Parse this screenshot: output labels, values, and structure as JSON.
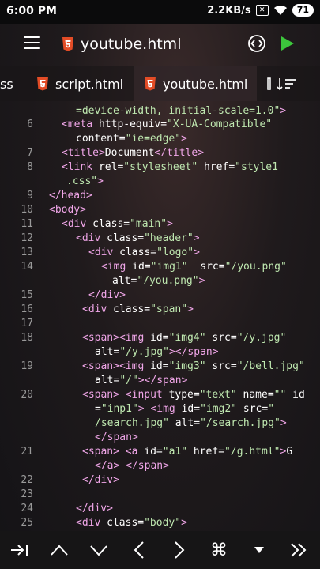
{
  "statusbar": {
    "time": "6:00 PM",
    "speed": "2.2KB/s",
    "battery": "71"
  },
  "appbar": {
    "title": "youtube.html"
  },
  "tabs": [
    {
      "label": "ss"
    },
    {
      "label": "script.html"
    },
    {
      "label": "youtube.html"
    }
  ],
  "colors": {
    "accent_play": "#3cc63c",
    "html_badge": "#e34c26",
    "tag": "#f0a6e8",
    "string": "#bfe8b0"
  },
  "editor": {
    "lines": [
      {
        "ln": "",
        "parts": [
          {
            "t": "str",
            "v": "=device-width, initial-scale=1.0\""
          },
          {
            "t": "tag",
            "v": ">"
          }
        ]
      },
      {
        "ln": "6",
        "parts": [
          {
            "t": "tag",
            "v": "<meta "
          },
          {
            "t": "attr",
            "v": "http-equiv="
          },
          {
            "t": "str",
            "v": "\"X-UA-Compatible\""
          }
        ]
      },
      {
        "ln": "",
        "parts": [
          {
            "t": "attr",
            "v": "content="
          },
          {
            "t": "str",
            "v": "\"ie=edge\""
          },
          {
            "t": "tag",
            "v": ">"
          }
        ]
      },
      {
        "ln": "7",
        "parts": [
          {
            "t": "tag",
            "v": "<title>"
          },
          {
            "t": "txt",
            "v": "Document"
          },
          {
            "t": "tag",
            "v": "</title>"
          }
        ]
      },
      {
        "ln": "8",
        "parts": [
          {
            "t": "tag",
            "v": "<link "
          },
          {
            "t": "attr",
            "v": "rel="
          },
          {
            "t": "str",
            "v": "\"stylesheet\""
          },
          {
            "t": "attr",
            "v": " href="
          },
          {
            "t": "str",
            "v": "\"style1"
          }
        ]
      },
      {
        "ln": "",
        "parts": [
          {
            "t": "str",
            "v": ".css\""
          },
          {
            "t": "tag",
            "v": ">"
          }
        ]
      },
      {
        "ln": "9",
        "parts": [
          {
            "t": "tag",
            "v": "</head>"
          }
        ]
      },
      {
        "ln": "10",
        "parts": [
          {
            "t": "tag",
            "v": "<body>"
          }
        ]
      },
      {
        "ln": "11",
        "parts": [
          {
            "t": "tag",
            "v": "<div "
          },
          {
            "t": "attr",
            "v": "class="
          },
          {
            "t": "str",
            "v": "\"main\""
          },
          {
            "t": "tag",
            "v": ">"
          }
        ]
      },
      {
        "ln": "12",
        "parts": [
          {
            "t": "tag",
            "v": "<div "
          },
          {
            "t": "attr",
            "v": "class="
          },
          {
            "t": "str",
            "v": "\"header\""
          },
          {
            "t": "tag",
            "v": ">"
          }
        ]
      },
      {
        "ln": "13",
        "parts": [
          {
            "t": "tag",
            "v": "<div "
          },
          {
            "t": "attr",
            "v": "class="
          },
          {
            "t": "str",
            "v": "\"logo\""
          },
          {
            "t": "tag",
            "v": ">"
          }
        ]
      },
      {
        "ln": "14",
        "parts": [
          {
            "t": "tag",
            "v": "<img "
          },
          {
            "t": "attr",
            "v": "id="
          },
          {
            "t": "str",
            "v": "\"img1\""
          },
          {
            "t": "attr",
            "v": "  src="
          },
          {
            "t": "str",
            "v": "\"/you.png\""
          }
        ]
      },
      {
        "ln": "",
        "parts": [
          {
            "t": "attr",
            "v": "alt="
          },
          {
            "t": "str",
            "v": "\"/you.png\""
          },
          {
            "t": "tag",
            "v": ">"
          }
        ]
      },
      {
        "ln": "15",
        "parts": [
          {
            "t": "tag",
            "v": "</div>"
          }
        ]
      },
      {
        "ln": "16",
        "parts": [
          {
            "t": "tag",
            "v": "<div "
          },
          {
            "t": "attr",
            "v": "class="
          },
          {
            "t": "str",
            "v": "\"span\""
          },
          {
            "t": "tag",
            "v": ">"
          }
        ]
      },
      {
        "ln": "17",
        "parts": []
      },
      {
        "ln": "18",
        "parts": [
          {
            "t": "tag",
            "v": "<span><img "
          },
          {
            "t": "attr",
            "v": "id="
          },
          {
            "t": "str",
            "v": "\"img4\""
          },
          {
            "t": "attr",
            "v": " src="
          },
          {
            "t": "str",
            "v": "\"/y.jpg\""
          }
        ]
      },
      {
        "ln": "",
        "parts": [
          {
            "t": "attr",
            "v": "alt="
          },
          {
            "t": "str",
            "v": "\"/y.jpg\""
          },
          {
            "t": "tag",
            "v": "></span>"
          }
        ]
      },
      {
        "ln": "19",
        "parts": [
          {
            "t": "tag",
            "v": "<span><img "
          },
          {
            "t": "attr",
            "v": "id="
          },
          {
            "t": "str",
            "v": "\"img3\""
          },
          {
            "t": "attr",
            "v": " src="
          },
          {
            "t": "str",
            "v": "\"/bell.jpg\""
          }
        ]
      },
      {
        "ln": "",
        "parts": [
          {
            "t": "attr",
            "v": "alt="
          },
          {
            "t": "str",
            "v": "\"/\""
          },
          {
            "t": "tag",
            "v": "></span>"
          }
        ]
      },
      {
        "ln": "20",
        "parts": [
          {
            "t": "tag",
            "v": "<span> <input "
          },
          {
            "t": "attr",
            "v": "type="
          },
          {
            "t": "str",
            "v": "\"text\""
          },
          {
            "t": "attr",
            "v": " name="
          },
          {
            "t": "str",
            "v": "\"\""
          },
          {
            "t": "attr",
            "v": " id"
          }
        ]
      },
      {
        "ln": "",
        "parts": [
          {
            "t": "attr",
            "v": "="
          },
          {
            "t": "str",
            "v": "\"inp1\""
          },
          {
            "t": "tag",
            "v": "> <img "
          },
          {
            "t": "attr",
            "v": "id="
          },
          {
            "t": "str",
            "v": "\"img2\""
          },
          {
            "t": "attr",
            "v": " src="
          },
          {
            "t": "str",
            "v": "\""
          }
        ]
      },
      {
        "ln": "",
        "parts": [
          {
            "t": "str",
            "v": "/search.jpg\""
          },
          {
            "t": "attr",
            "v": " alt="
          },
          {
            "t": "str",
            "v": "\"/search.jpg\""
          },
          {
            "t": "tag",
            "v": ">"
          }
        ]
      },
      {
        "ln": "",
        "parts": [
          {
            "t": "tag",
            "v": "</span>"
          }
        ]
      },
      {
        "ln": "21",
        "parts": [
          {
            "t": "tag",
            "v": "<span> <a "
          },
          {
            "t": "attr",
            "v": "id="
          },
          {
            "t": "str",
            "v": "\"a1\""
          },
          {
            "t": "attr",
            "v": " href="
          },
          {
            "t": "str",
            "v": "\"/g.html\""
          },
          {
            "t": "tag",
            "v": ">"
          },
          {
            "t": "txt",
            "v": "G"
          }
        ]
      },
      {
        "ln": "",
        "parts": [
          {
            "t": "tag",
            "v": "</a> </span>"
          }
        ]
      },
      {
        "ln": "22",
        "parts": [
          {
            "t": "tag",
            "v": "</div>"
          }
        ]
      },
      {
        "ln": "23",
        "parts": []
      },
      {
        "ln": "24",
        "parts": [
          {
            "t": "tag",
            "v": "</div>"
          }
        ]
      },
      {
        "ln": "25",
        "parts": [
          {
            "t": "tag",
            "v": "<div "
          },
          {
            "t": "attr",
            "v": "class="
          },
          {
            "t": "str",
            "v": "\"body\""
          },
          {
            "t": "tag",
            "v": ">"
          }
        ]
      }
    ]
  },
  "bottombar": {
    "buttons": [
      {
        "name": "tab-indent",
        "glyph": "→|"
      },
      {
        "name": "caret-up",
        "glyph": "∧"
      },
      {
        "name": "caret-down",
        "glyph": "∨"
      },
      {
        "name": "angle-left",
        "glyph": "<"
      },
      {
        "name": "angle-right",
        "glyph": ">"
      },
      {
        "name": "command",
        "glyph": "⌘"
      },
      {
        "name": "triangle-down",
        "glyph": "▼"
      },
      {
        "name": "double-angle-right",
        "glyph": "»"
      }
    ]
  }
}
